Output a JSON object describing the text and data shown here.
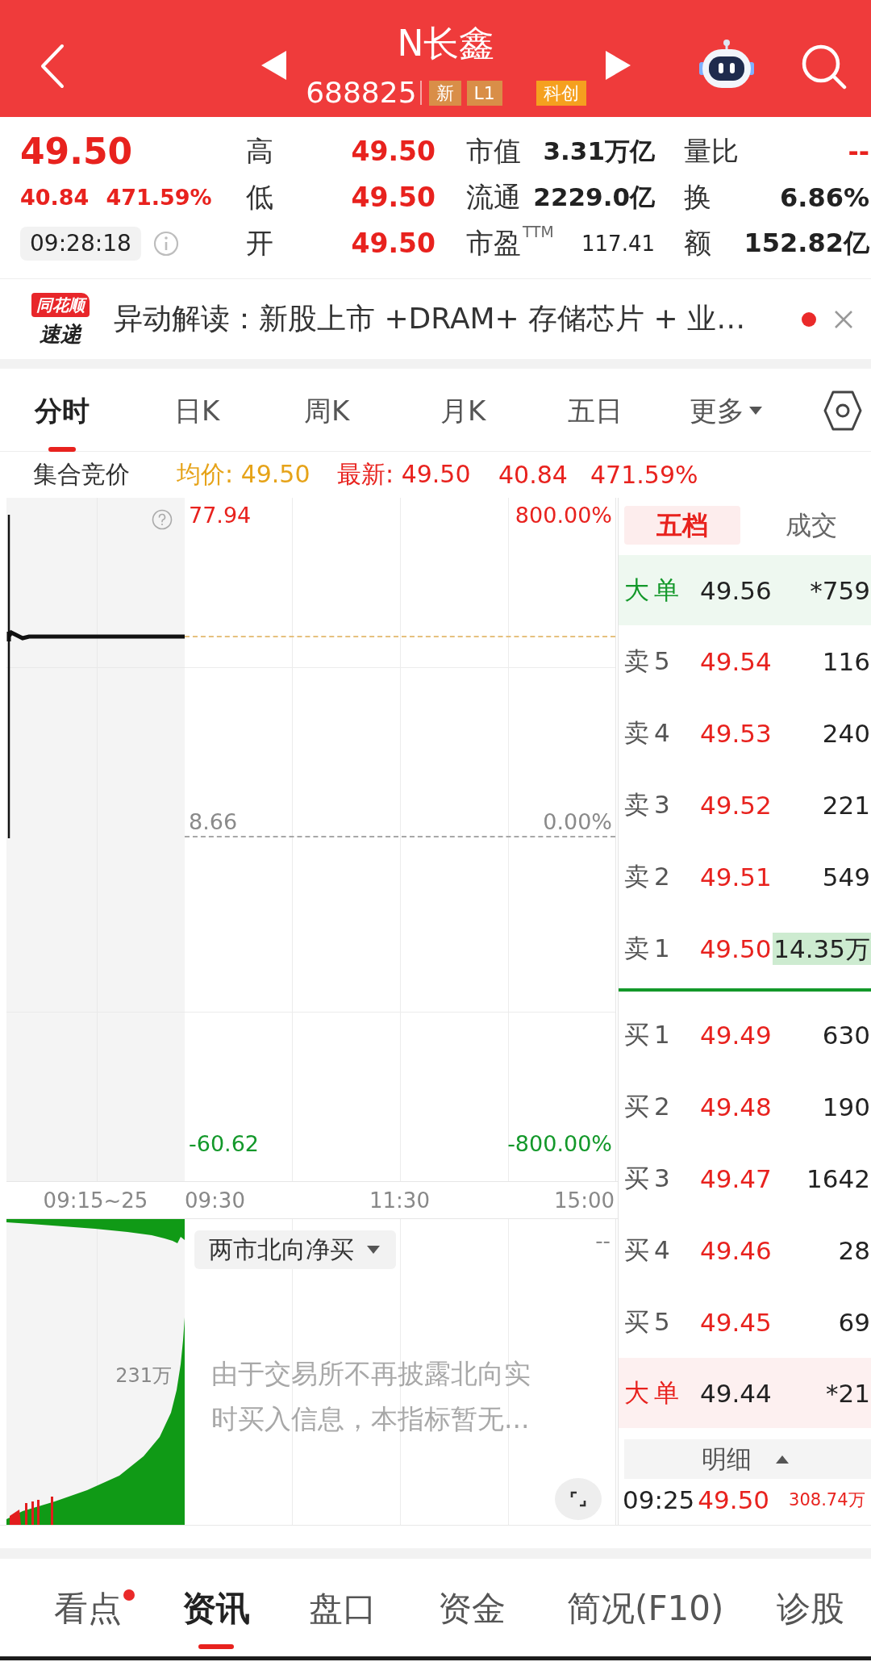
{
  "header": {
    "title": "N长鑫",
    "code": "688825",
    "badges": [
      {
        "text": "新",
        "kind": "new"
      },
      {
        "text": "L1",
        "kind": "level"
      },
      {
        "text": "科创",
        "kind": "board"
      }
    ]
  },
  "quote": {
    "price": "49.50",
    "change": "40.84",
    "change_percent": "471.59%",
    "time": "09:28:18",
    "prices": [
      {
        "label": "高",
        "value": "49.50"
      },
      {
        "label": "低",
        "value": "49.50"
      },
      {
        "label": "开",
        "value": "49.50"
      }
    ],
    "metrics": [
      {
        "label": "市值",
        "value": "3.31万亿",
        "kind": "amount"
      },
      {
        "label": "流通",
        "value": "2229.0亿",
        "kind": "amount"
      },
      {
        "label": "市盈$^{TTM}$",
        "value": "117.41",
        "kind": "ratio"
      }
    ],
    "ratios": [
      {
        "label": "量比",
        "value": "--",
        "kind": "up"
      },
      {
        "label": "换",
        "value": "6.86%",
        "kind": "neutral"
      },
      {
        "label": "额",
        "value": "152.82亿",
        "kind": "neutral"
      }
    ]
  },
  "news": {
    "brand": "同花顺",
    "subtitle": "速递",
    "text": "异动解读：新股上市 +DRAM+ 存储芯片 + 业…",
    "unread": true
  },
  "chart_tabs": [
    {
      "label": "分时",
      "kind": "period",
      "selected": true
    },
    {
      "label": "日K",
      "kind": "period",
      "selected": false
    },
    {
      "label": "周K",
      "kind": "period",
      "selected": false
    },
    {
      "label": "月K",
      "kind": "period",
      "selected": false
    },
    {
      "label": "五日",
      "kind": "period",
      "selected": false
    },
    {
      "label": "更多",
      "kind": "menu",
      "selected": false
    }
  ],
  "auction": {
    "label": "集合竞价",
    "average": "均价: 49.50",
    "latest": "最新: 49.50",
    "change": "40.84",
    "change_percent": "471.59%"
  },
  "price_chart": {
    "axis": [
      {
        "price": "77.94",
        "percent": "800.00%",
        "kind": "up"
      },
      {
        "price": "8.66",
        "percent": "0.00%",
        "kind": "flat"
      },
      {
        "price": "-60.62",
        "percent": "-800.00%",
        "kind": "down"
      }
    ],
    "times": [
      "09:15~25",
      "09:30",
      "11:30",
      "15:00"
    ]
  },
  "indicator": {
    "selector": "两市北向净买",
    "value": "--",
    "axis_label": "231万",
    "notice": "由于交易所不再披露北向实时买入信息，本指标暂无..."
  },
  "order_book": {
    "tabs": [
      {
        "label": "五档",
        "selected": true
      },
      {
        "label": "成交",
        "selected": false
      }
    ],
    "asks": [
      {
        "kind": "big",
        "label": "大单",
        "price": "49.56",
        "volume": "*759",
        "highlighted": false
      },
      {
        "kind": "level",
        "label": "卖5",
        "price": "49.54",
        "volume": "116",
        "highlighted": false
      },
      {
        "kind": "level",
        "label": "卖4",
        "price": "49.53",
        "volume": "240",
        "highlighted": false
      },
      {
        "kind": "level",
        "label": "卖3",
        "price": "49.52",
        "volume": "221",
        "highlighted": false
      },
      {
        "kind": "level",
        "label": "卖2",
        "price": "49.51",
        "volume": "549",
        "highlighted": false
      },
      {
        "kind": "level",
        "label": "卖1",
        "price": "49.50",
        "volume": "14.35万",
        "highlighted": true
      }
    ],
    "bids": [
      {
        "kind": "level",
        "label": "买1",
        "price": "49.49",
        "volume": "630",
        "highlighted": false
      },
      {
        "kind": "level",
        "label": "买2",
        "price": "49.48",
        "volume": "190",
        "highlighted": false
      },
      {
        "kind": "level",
        "label": "买3",
        "price": "49.47",
        "volume": "1642",
        "highlighted": false
      },
      {
        "kind": "level",
        "label": "买4",
        "price": "49.46",
        "volume": "28",
        "highlighted": false
      },
      {
        "kind": "level",
        "label": "买5",
        "price": "49.45",
        "volume": "69",
        "highlighted": false
      },
      {
        "kind": "big",
        "label": "大单",
        "price": "49.44",
        "volume": "*21",
        "highlighted": false
      }
    ],
    "detail": {
      "label": "明细",
      "expanded": true
    },
    "trades": [
      {
        "time": "09:25",
        "price": "49.50",
        "volume": "308.74万"
      }
    ]
  },
  "bottom_nav": [
    {
      "label": "看点",
      "selected": false,
      "badge": true
    },
    {
      "label": "资讯",
      "selected": true,
      "badge": false
    },
    {
      "label": "盘口",
      "selected": false,
      "badge": false
    },
    {
      "label": "资金",
      "selected": false,
      "badge": false
    },
    {
      "label": "简况(F10)",
      "selected": false,
      "badge": false
    },
    {
      "label": "诊股",
      "selected": false,
      "badge": false
    }
  ]
}
